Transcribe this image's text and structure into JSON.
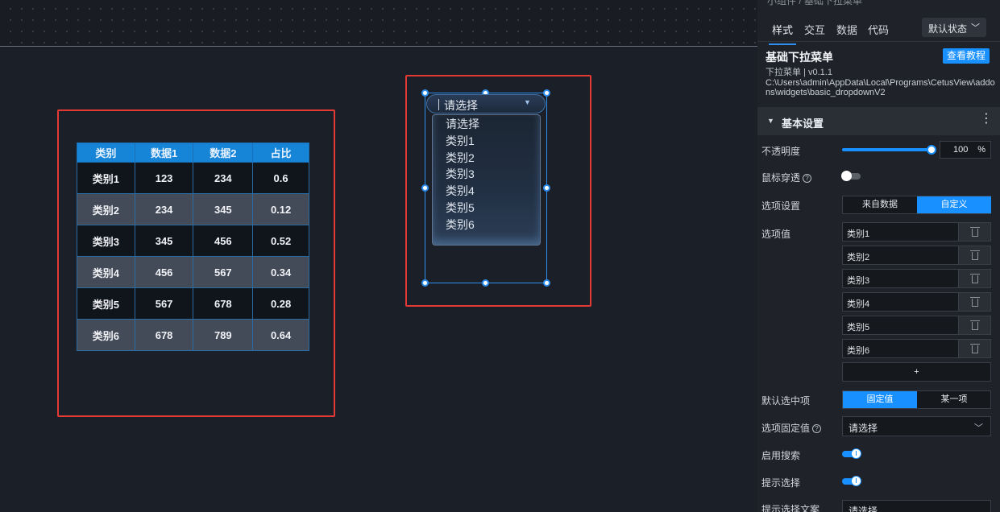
{
  "canvas": {
    "table": {
      "headers": [
        "类别",
        "数据1",
        "数据2",
        "占比"
      ],
      "rows": [
        [
          "类别1",
          "123",
          "234",
          "0.6"
        ],
        [
          "类别2",
          "234",
          "345",
          "0.12"
        ],
        [
          "类别3",
          "345",
          "456",
          "0.52"
        ],
        [
          "类别4",
          "456",
          "567",
          "0.34"
        ],
        [
          "类别5",
          "567",
          "678",
          "0.28"
        ],
        [
          "类别6",
          "678",
          "789",
          "0.64"
        ]
      ]
    },
    "dropdown": {
      "selected": "请选择",
      "options": [
        "请选择",
        "类别1",
        "类别2",
        "类别3",
        "类别4",
        "类别5",
        "类别6"
      ]
    }
  },
  "panel": {
    "top_cut": "小组件 / 基础下拉菜单",
    "tabs": [
      "样式",
      "交互",
      "数据",
      "代码"
    ],
    "state_select": "默认状态",
    "widget_name": "基础下拉菜单",
    "widget_version": "下拉菜单 | v0.1.1",
    "widget_path": "C:\\Users\\admin\\AppData\\Local\\Programs\\CetusView\\addons\\widgets\\basic_dropdownV2",
    "tutorial_button": "查看教程",
    "section_title": "基本设置",
    "opacity": {
      "label": "不透明度",
      "value": "100",
      "unit": "%",
      "fraction": 1.0
    },
    "mouse_through": {
      "label": "鼠标穿透",
      "on": false
    },
    "option_source": {
      "label": "选项设置",
      "choices": [
        "来自数据",
        "自定义"
      ],
      "active": "自定义"
    },
    "option_values": {
      "label": "选项值",
      "items": [
        "类别1",
        "类别2",
        "类别3",
        "类别4",
        "类别5",
        "类别6"
      ],
      "add_label": "+"
    },
    "default_selected": {
      "label": "默认选中项",
      "choices": [
        "固定值",
        "某一项"
      ],
      "active": "固定值"
    },
    "fixed_value": {
      "label": "选项固定值",
      "value": "请选择"
    },
    "enable_search": {
      "label": "启用搜索",
      "on": true
    },
    "hint_select": {
      "label": "提示选择",
      "on": true
    },
    "hint_text": {
      "label": "提示选择文案",
      "value": "请选择"
    }
  },
  "colors": {
    "accent": "#1890ff",
    "selection": "#e53935",
    "canvas_bg": "#1b1f27",
    "panel_bg": "#1f2228"
  }
}
